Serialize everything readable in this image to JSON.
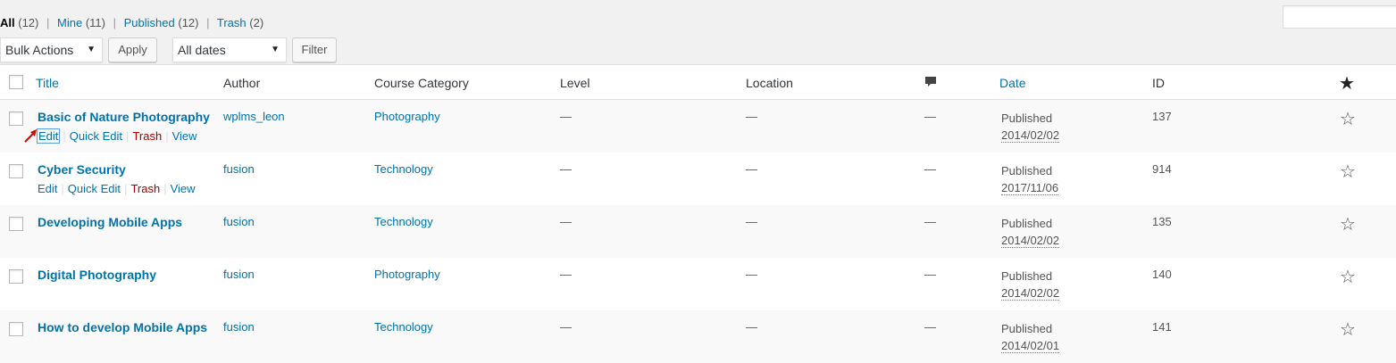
{
  "views": {
    "all": {
      "label": "All",
      "count": "(12)"
    },
    "mine": {
      "label": "Mine",
      "count": "(11)"
    },
    "published": {
      "label": "Published",
      "count": "(12)"
    },
    "trash": {
      "label": "Trash",
      "count": "(2)"
    },
    "separator": "|"
  },
  "search": {
    "value": ""
  },
  "tablenav": {
    "bulk_actions": "Bulk Actions",
    "apply": "Apply",
    "dates": "All dates",
    "filter": "Filter"
  },
  "columns": {
    "title": "Title",
    "author": "Author",
    "category": "Course Category",
    "level": "Level",
    "location": "Location",
    "comments_icon": "comment-icon",
    "date": "Date",
    "id": "ID",
    "featured_icon": "star-filled-icon"
  },
  "row_actions": {
    "edit": "Edit",
    "quick_edit": "Quick Edit",
    "trash": "Trash",
    "view": "View",
    "separator": "|"
  },
  "rows": [
    {
      "title": "Basic of Nature Photography",
      "author": "wplms_leon",
      "category": "Photography",
      "level": "—",
      "location": "—",
      "comments": "—",
      "status": "Published",
      "date": "2014/02/02",
      "id": "137",
      "show_actions": true
    },
    {
      "title": "Cyber Security",
      "author": "fusion",
      "category": "Technology",
      "level": "—",
      "location": "—",
      "comments": "—",
      "status": "Published",
      "date": "2017/11/06",
      "id": "914",
      "show_actions": true
    },
    {
      "title": "Developing Mobile Apps",
      "author": "fusion",
      "category": "Technology",
      "level": "—",
      "location": "—",
      "comments": "—",
      "status": "Published",
      "date": "2014/02/02",
      "id": "135",
      "show_actions": false
    },
    {
      "title": "Digital Photography",
      "author": "fusion",
      "category": "Photography",
      "level": "—",
      "location": "—",
      "comments": "—",
      "status": "Published",
      "date": "2014/02/02",
      "id": "140",
      "show_actions": false
    },
    {
      "title": "How to develop Mobile Apps",
      "author": "fusion",
      "category": "Technology",
      "level": "—",
      "location": "—",
      "comments": "—",
      "status": "Published",
      "date": "2014/02/01",
      "id": "141",
      "show_actions": false
    }
  ],
  "colors": {
    "link": "#0073aa",
    "trash": "#a00",
    "annotation_arrow": "#e00000"
  }
}
